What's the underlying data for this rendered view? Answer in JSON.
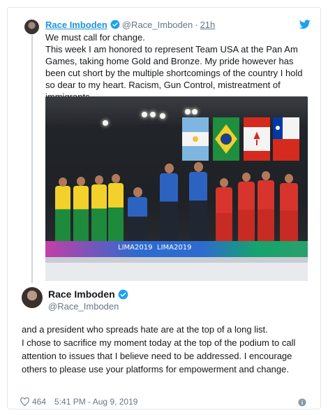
{
  "quoted_tweet": {
    "name": "Race Imboden",
    "handle": "@Race_Imboden",
    "dot": "·",
    "time": "21h",
    "lines": [
      "We must call for change.",
      "This week I am honored to represent Team USA at the Pan Am Games, taking home Gold and Bronze. My pride however has been cut short by the multiple shortcomings of the country I hold so dear to my heart. Racism, Gun Control, mistreatment of immigrants,"
    ],
    "photo": {
      "banner_text_left": "LIMA2019",
      "banner_text_right": "LIMA2019"
    }
  },
  "main_tweet": {
    "name": "Race Imboden",
    "handle": "@Race_Imboden",
    "lines": [
      "and a president who spreads hate are at the top of a long list.",
      "I chose to sacrifice my moment today at the top of the podium to call attention to issues that I believe need to be addressed.  I encourage others to please use your platforms for empowerment and change."
    ],
    "likes": "464",
    "timestamp": "5:41 PM - Aug 9, 2019"
  },
  "icons": {
    "verified": "verified-badge-icon",
    "twitter": "twitter-bird-icon",
    "heart": "heart-icon",
    "info": "info-icon"
  },
  "colors": {
    "link_blue": "#1b95e0",
    "verified_blue": "#1da1f2",
    "muted": "#657786",
    "border": "#e1e8ed"
  }
}
